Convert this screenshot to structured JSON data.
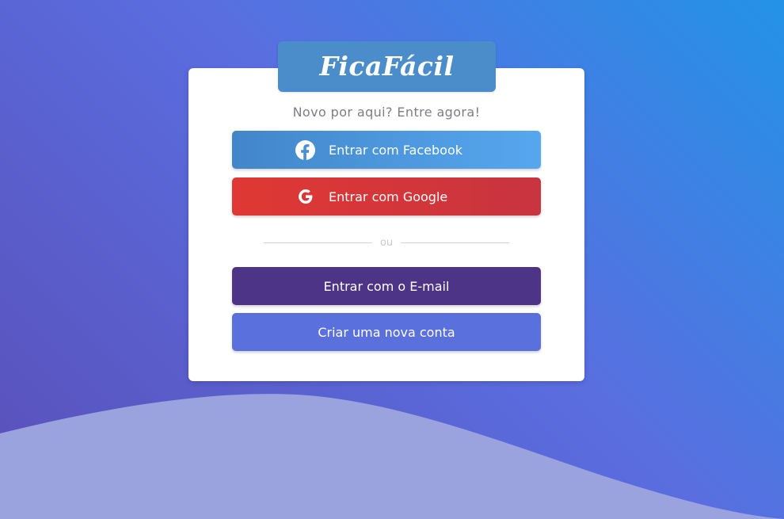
{
  "brand": {
    "logo_text": "FicaFácil",
    "colors": {
      "background_top_right": "#2393e7",
      "background_bottom_left": "#5a4fb8",
      "logo_tab": "#4b8ccb",
      "wave": "#9aa3dd"
    }
  },
  "login": {
    "subtitle": "Novo por aqui? Entre agora!",
    "facebook": {
      "label": "Entrar com Facebook",
      "icon": "facebook-icon",
      "color": "#4a90d6"
    },
    "google": {
      "label": "Entrar com Google",
      "icon": "google-icon",
      "color": "#d4363a"
    },
    "divider_text": "ou",
    "email": {
      "label": "Entrar com o E-mail",
      "color": "#4d3486"
    },
    "create_account": {
      "label": "Criar uma nova conta",
      "color": "#5a70dc"
    }
  }
}
